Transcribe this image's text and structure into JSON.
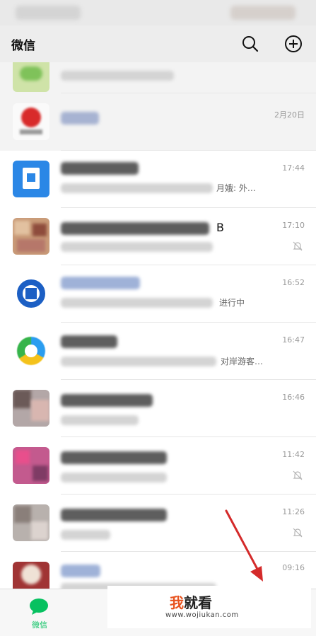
{
  "header": {
    "title": "微信"
  },
  "icons": {
    "search": "search-icon",
    "add": "plus-circle-icon",
    "mute": "bell-off-icon",
    "chat_tab": "chat-bubble-icon"
  },
  "chats": [
    {
      "time": "",
      "message": "",
      "muted": false
    },
    {
      "time": "2月20日",
      "message": "",
      "muted": false
    },
    {
      "time": "17:44",
      "message": "月娥: 外…",
      "muted": false
    },
    {
      "time": "17:10",
      "message": "B",
      "muted": true
    },
    {
      "time": "16:52",
      "message": "进行中",
      "muted": false
    },
    {
      "time": "16:47",
      "message": "对岸游客…",
      "muted": false
    },
    {
      "time": "16:46",
      "message": "",
      "muted": false
    },
    {
      "time": "11:42",
      "message": "",
      "muted": true
    },
    {
      "time": "11:26",
      "message": "",
      "muted": true
    },
    {
      "time": "09:16",
      "message": "",
      "muted": false
    }
  ],
  "tabbar": {
    "chats_label": "微信"
  },
  "watermark": {
    "brand_a": "我",
    "brand_b": "就看",
    "url": "www.wojiukan.com"
  },
  "colors": {
    "wechat_green": "#07c160",
    "arrow_red": "#d42a2a",
    "background": "#ededed"
  }
}
